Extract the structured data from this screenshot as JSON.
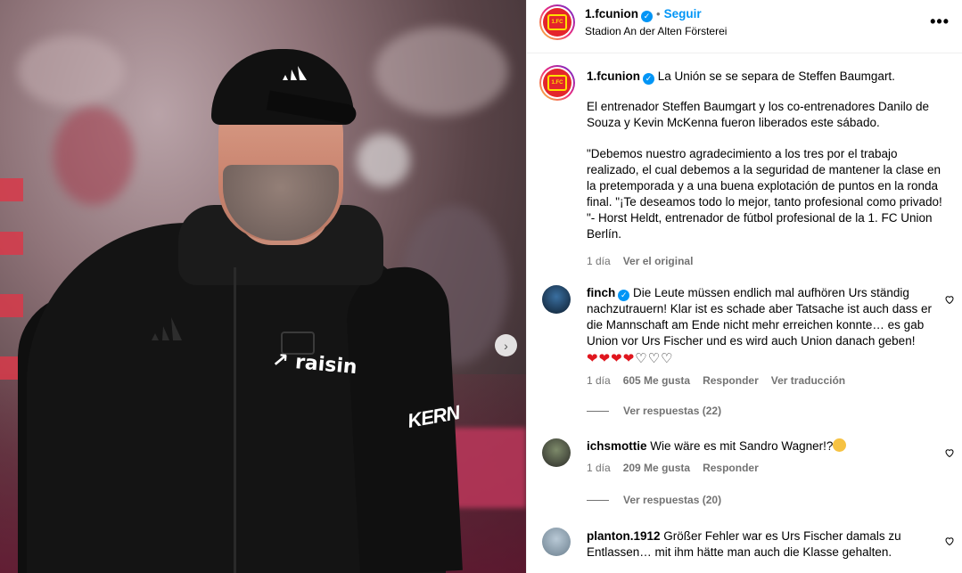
{
  "photo": {
    "chest_brand": "raisin",
    "sleeve_brand": "KERN",
    "next_icon": "chevron-right-icon"
  },
  "header": {
    "username": "1.fcunion",
    "follow_label": "Seguir",
    "location": "Stadion An der Alten Försterei",
    "more_icon": "more-horizontal-icon",
    "separator": "•"
  },
  "caption": {
    "username": "1.fcunion",
    "headline": "La Unión se se separa de Steffen Baumgart.",
    "paragraph1": "El entrenador Steffen Baumgart y los co-entrenadores Danilo de Souza y Kevin McKenna fueron liberados este sábado.",
    "paragraph2": "\"Debemos nuestro agradecimiento a los tres por el trabajo realizado, el cual debemos a la seguridad de mantener la clase en la pretemporada y a una buena explotación de puntos en la ronda final. \"¡Te deseamos todo lo mejor, tanto profesional como privado! \"- Horst Heldt, entrenador de fútbol profesional de la 1. FC Union Berlín.",
    "time": "1 día",
    "see_original": "Ver el original"
  },
  "comments": [
    {
      "username": "finch",
      "verified": true,
      "text": "Die Leute müssen endlich mal aufhören Urs ständig nachzutrauern! Klar ist es schade aber Tatsache ist auch dass er die Mannschaft am Ende nicht mehr erreichen konnte… es gab Union vor Urs Fischer und es wird auch Union danach geben!",
      "hearts": "❤❤❤❤♡♡♡",
      "time": "1 día",
      "likes": "605 Me gusta",
      "reply": "Responder",
      "translate": "Ver traducción",
      "view_replies": "Ver respuestas (22)"
    },
    {
      "username": "ichsmottie",
      "text": "Wie wäre es mit Sandro Wagner!?",
      "time": "1 día",
      "likes": "209 Me gusta",
      "reply": "Responder",
      "view_replies": "Ver respuestas (20)"
    },
    {
      "username": "planton.1912",
      "text": "Größer Fehler war es Urs Fischer damals zu Entlassen… mit ihm hätte man auch die Klasse gehalten."
    }
  ],
  "colors": {
    "accent": "#0095f6",
    "club_red": "#e4252b",
    "heart_red": "#e0161e",
    "muted": "#737373"
  }
}
